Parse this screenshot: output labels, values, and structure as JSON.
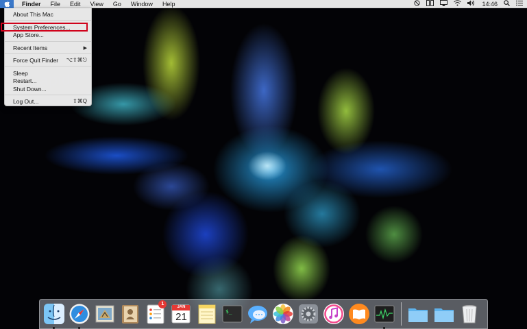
{
  "menubar": {
    "apple_icon": "apple-logo-icon",
    "app_name": "Finder",
    "menus": [
      "File",
      "Edit",
      "View",
      "Go",
      "Window",
      "Help"
    ],
    "status_icons": [
      "do-not-disturb-icon",
      "split-view-icon",
      "airplay-icon",
      "wifi-icon",
      "volume-icon"
    ],
    "clock": "14:46",
    "right_icons": [
      "spotlight-search-icon",
      "notification-center-icon"
    ]
  },
  "apple_menu": {
    "items": [
      {
        "label": "About This Mac",
        "shortcut": ""
      },
      {
        "label": "System Preferences...",
        "shortcut": "",
        "highlighted": true
      },
      {
        "label": "App Store...",
        "shortcut": ""
      },
      {
        "label": "Recent Items",
        "shortcut": "",
        "submenu": true
      },
      {
        "label": "Force Quit Finder",
        "shortcut": "⌥⇧⌘⎋"
      },
      {
        "label": "Sleep",
        "shortcut": ""
      },
      {
        "label": "Restart...",
        "shortcut": ""
      },
      {
        "label": "Shut Down...",
        "shortcut": ""
      },
      {
        "label": "Log Out...",
        "shortcut": "⇧⌘Q"
      }
    ]
  },
  "dock": {
    "apps": [
      {
        "name": "finder-icon",
        "running": true
      },
      {
        "name": "safari-icon",
        "running": true
      },
      {
        "name": "mail-icon",
        "running": false
      },
      {
        "name": "contacts-icon",
        "running": false
      },
      {
        "name": "reminders-icon",
        "running": false,
        "badge": "1"
      },
      {
        "name": "calendar-icon",
        "running": false,
        "month": "JAN",
        "day": "21"
      },
      {
        "name": "notes-icon",
        "running": false
      },
      {
        "name": "terminal-icon",
        "running": false
      },
      {
        "name": "messages-icon",
        "running": false
      },
      {
        "name": "photos-icon",
        "running": false
      },
      {
        "name": "system-preferences-icon",
        "running": false
      },
      {
        "name": "itunes-icon",
        "running": false
      },
      {
        "name": "ibooks-icon",
        "running": false
      },
      {
        "name": "activity-monitor-icon",
        "running": true
      }
    ],
    "right_items": [
      "applications-folder-icon",
      "documents-folder-icon",
      "trash-icon"
    ]
  },
  "colors": {
    "menubar_bg": "#e6e6e6",
    "apple_highlight": "#3a78c9",
    "highlight_box": "#d0021b",
    "badge": "#e53935"
  }
}
